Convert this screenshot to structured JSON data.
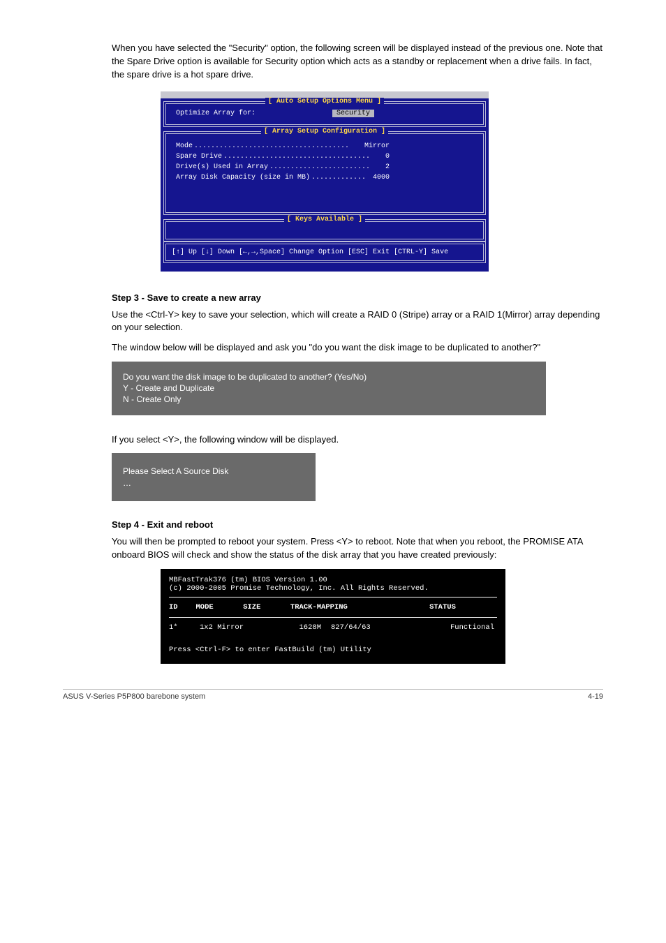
{
  "intro": {
    "p1": "When you have selected the \"Security\" option, the following screen will be displayed instead of the previous one. Note that the Spare Drive option is available for Security option which acts as a standby or replacement when a drive fails. In fact, the spare drive is a hot spare drive."
  },
  "bios": {
    "menu_title": "[ Auto Setup Options Menu ]",
    "optimize_label": "Optimize Array for:",
    "optimize_value": "Security",
    "config_title": "[ Array Setup Configuration ]",
    "rows": [
      {
        "label": "Mode",
        "value": "Mirror"
      },
      {
        "label": "Spare Drive",
        "value": "0"
      },
      {
        "label": "Drive(s) Used in Array",
        "value": "2"
      },
      {
        "label": "Array Disk Capacity (size in MB)",
        "value": "4000"
      }
    ],
    "keys_title": "[ Keys Available ]",
    "keys_line": "[↑] Up  [↓] Down  [←,→,Space] Change Option  [ESC] Exit  [CTRL-Y] Save"
  },
  "step3_heading": "Step 3 - Save to create a new array",
  "step3_p1": "Use the <Ctrl-Y> key to save your selection, which will create a RAID 0 (Stripe) array or a RAID 1(Mirror) array depending on your selection.",
  "step3_p2": "The window below will be displayed and ask you \"do you want the disk image to be duplicated to another?\"",
  "banner1": {
    "line1": "Do you want the disk image to be duplicated to another? (Yes/No)",
    "line2": "Y - Create and Duplicate",
    "line3": "N - Create Only"
  },
  "after_banner1": "If you select <Y>, the following window will be displayed.",
  "banner2": {
    "line1": "Please Select A Source Disk",
    "lines_rest": "…"
  },
  "step4_heading": "Step 4 - Exit and reboot",
  "step4_p1": "You will then be prompted to reboot your system. Press <Y> to reboot. Note that when you reboot, the PROMISE ATA onboard BIOS will check and show the status of the disk array that you have created previously:",
  "term": {
    "line1": "MBFastTrak376 (tm) BIOS Version 1.00",
    "line2": "(c) 2000-2005 Promise Technology, Inc.  All Rights Reserved.",
    "headers": {
      "id": "ID",
      "mode": "MODE",
      "size": "SIZE",
      "track": "TRACK-MAPPING",
      "status": "STATUS"
    },
    "row": {
      "id": "1*",
      "mode": "1x2 Mirror",
      "size": "1628M",
      "track": "827/64/63",
      "status": "Functional"
    },
    "prompt": "Press <Ctrl-F> to enter FastBuild (tm) Utility"
  },
  "footer": {
    "left": "ASUS V-Series P5P800 barebone system",
    "right": "4-19"
  },
  "chart_data": {
    "type": "table",
    "title": "Array Setup Configuration",
    "rows": [
      {
        "field": "Optimize Array for",
        "value": "Security"
      },
      {
        "field": "Mode",
        "value": "Mirror"
      },
      {
        "field": "Spare Drive",
        "value": 0
      },
      {
        "field": "Drive(s) Used in Array",
        "value": 2
      },
      {
        "field": "Array Disk Capacity (size in MB)",
        "value": 4000
      }
    ],
    "bios_status_table": {
      "columns": [
        "ID",
        "MODE",
        "SIZE",
        "TRACK-MAPPING",
        "STATUS"
      ],
      "rows": [
        [
          "1*",
          "1x2 Mirror",
          "1628M",
          "827/64/63",
          "Functional"
        ]
      ]
    }
  }
}
